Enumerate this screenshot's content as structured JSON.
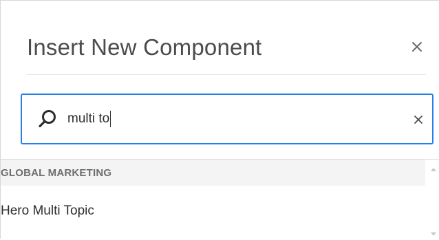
{
  "dialog": {
    "title": "Insert New Component",
    "close_icon": "close-icon"
  },
  "search": {
    "value": "multi to",
    "search_icon": "search-icon",
    "clear_icon": "clear-icon"
  },
  "results": {
    "groups": [
      {
        "label": "GLOBAL MARKETING",
        "items": [
          {
            "label": "Hero Multi Topic"
          }
        ]
      }
    ]
  },
  "colors": {
    "focus_border": "#2680eb",
    "title_text": "#4b4b4b",
    "group_header_bg": "#f4f4f4",
    "group_header_text": "#6e6e6e"
  }
}
